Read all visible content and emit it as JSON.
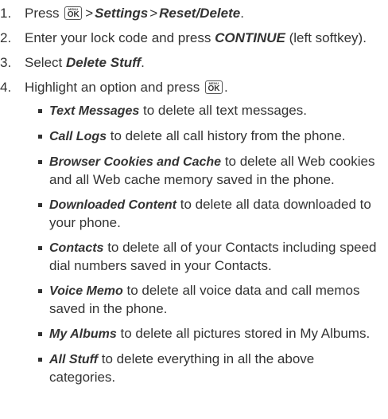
{
  "steps": [
    {
      "number": "1.",
      "pre": "Press",
      "key": {
        "top": "MENU",
        "main": "OK"
      },
      "arrow1": ">",
      "em1": "Settings",
      "arrow2": ">",
      "em2": "Reset/Delete",
      "post": "."
    },
    {
      "number": "2.",
      "pre": "Enter your lock code and press",
      "em": "CONTINUE",
      "post": "(left softkey)."
    },
    {
      "number": "3.",
      "pre": "Select",
      "em": "Delete Stuff",
      "post": "."
    },
    {
      "number": "4.",
      "pre": "Highlight an option and press",
      "key": {
        "top": "MENU",
        "main": "OK"
      },
      "post": "."
    }
  ],
  "options": [
    {
      "name": "Text Messages",
      "desc": "to delete all text messages."
    },
    {
      "name": "Call Logs",
      "desc": "to delete all call history from the phone."
    },
    {
      "name": "Browser Cookies and Cache",
      "desc": "to delete all Web cookies and all Web cache memory saved in the phone."
    },
    {
      "name": "Downloaded Content",
      "desc": "to delete all data downloaded to your phone."
    },
    {
      "name": "Contacts",
      "desc": "to delete all of your Contacts including speed dial numbers saved in your Contacts."
    },
    {
      "name": "Voice Memo",
      "desc": "to delete all voice data and call memos saved in the phone."
    },
    {
      "name": "My Albums",
      "desc": "to delete all pictures stored in My Albums."
    },
    {
      "name": "All Stuff",
      "desc": "to delete everything in all the above categories."
    }
  ]
}
